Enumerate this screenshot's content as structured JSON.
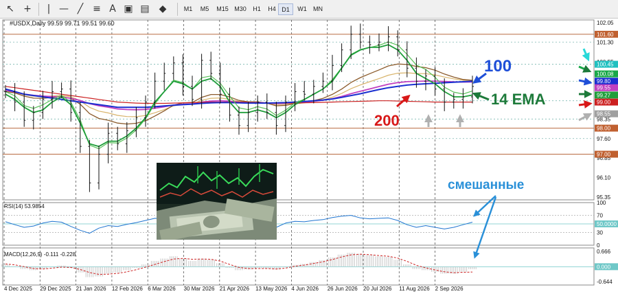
{
  "toolbar": {
    "icons": [
      "cursor-icon",
      "crosshair-icon",
      "horizontal-line-icon",
      "trendline-icon",
      "equidistant-channel-icon",
      "text-icon",
      "text-label-icon",
      "shapes-icon"
    ],
    "timeframes": [
      "M1",
      "M5",
      "M15",
      "M30",
      "H1",
      "H4",
      "D1",
      "W1",
      "MN"
    ],
    "active_timeframe": "D1"
  },
  "chart_header": {
    "symbol_line": "#USDX,Daily  99.59 99.71 99.51 99.60"
  },
  "indicators": {
    "rsi_label": "RSI(14) 53.9854",
    "macd_label": "MACD(12,26,9) -0.111 -0.228"
  },
  "annotations": {
    "label_100": "100",
    "label_200": "200",
    "label_ema": "14 EMA",
    "label_mixed": "смешанные"
  },
  "colors": {
    "price_bars": "#111111",
    "ema14": "#1e9e3a",
    "ema_brown": "#8b5a2b",
    "ema_tan": "#d8b36a",
    "ma_magenta": "#c040c0",
    "ma100_blue": "#1a2fd0",
    "ma200_red": "#cc2020",
    "rsi_line": "#1e74d0",
    "macd_hist": "#c8c8c8",
    "macd_signal": "#cc2020",
    "annotation_blue": "#1f4fd8",
    "annotation_red": "#d81818",
    "annotation_green": "#1d7a3a",
    "mixed_label": "#2a90d8"
  },
  "chart_data": [
    {
      "type": "line",
      "title": "#USDX,Daily",
      "x_tick_labels": [
        "4 Dec 2025",
        "29 Dec 2025",
        "21 Jan 2026",
        "12 Feb 2026",
        "6 Mar 2026",
        "30 Mar 2026",
        "21 Apr 2026",
        "13 May 2026",
        "4 Jun 2026",
        "26 Jun 2026",
        "20 Jul 2026",
        "11 Aug 2026",
        "2 Sep 2026"
      ],
      "y_tick_labels": [
        "102.05",
        "101.30",
        "100.55",
        "99.80",
        "99.05",
        "98.35",
        "97.60",
        "96.85",
        "96.10",
        "95.35"
      ],
      "price_tags": [
        {
          "label": "101.60",
          "value": 101.6,
          "color": "#c06030"
        },
        {
          "label": "100.45",
          "value": 100.45,
          "color": "#20c0c0"
        },
        {
          "label": "100.08",
          "value": 100.08,
          "color": "#18a848"
        },
        {
          "label": "99.80",
          "value": 99.8,
          "color": "#1a2fd0"
        },
        {
          "label": "99.55",
          "value": 99.55,
          "color": "#c040c0"
        },
        {
          "label": "99.27",
          "value": 99.27,
          "color": "#1e9e3a"
        },
        {
          "label": "99.00",
          "value": 99.0,
          "color": "#cc2020"
        },
        {
          "label": "98.55",
          "value": 98.55,
          "color": "#a0a0a0"
        },
        {
          "label": "98.00",
          "value": 98.0,
          "color": "#c06030"
        },
        {
          "label": "97.00",
          "value": 97.0,
          "color": "#c06030"
        }
      ],
      "horizontal_levels": [
        101.6,
        98.0,
        97.0
      ],
      "dashed_levels": [
        101.3,
        100.45,
        99.8,
        99.05,
        98.35,
        97.6
      ],
      "ylim": [
        95.25,
        102.15
      ],
      "series": [
        {
          "name": "close",
          "values": [
            99.4,
            99.0,
            98.3,
            98.6,
            99.1,
            99.4,
            99.5,
            98.6,
            97.3,
            95.9,
            97.0,
            97.8,
            97.4,
            97.9,
            98.4,
            99.0,
            99.8,
            100.1,
            100.5,
            99.6,
            99.1,
            100.6,
            100.1,
            99.3,
            98.5,
            98.1,
            98.6,
            99.0,
            98.6,
            98.1,
            99.0,
            99.4,
            99.3,
            99.6,
            99.8,
            100.4,
            101.0,
            101.6,
            101.3,
            101.2,
            101.3,
            101.5,
            101.0,
            100.3,
            99.8,
            100.0,
            99.5,
            99.0,
            99.1,
            99.2,
            99.6
          ]
        },
        {
          "name": "14 EMA",
          "values": [
            99.3,
            99.1,
            98.8,
            98.6,
            98.7,
            99.0,
            99.2,
            98.9,
            98.2,
            97.4,
            97.3,
            97.5,
            97.5,
            97.7,
            98.0,
            98.4,
            99.0,
            99.4,
            99.8,
            99.7,
            99.5,
            99.8,
            99.9,
            99.6,
            99.0,
            98.6,
            98.6,
            98.7,
            98.6,
            98.4,
            98.6,
            98.9,
            99.1,
            99.3,
            99.5,
            99.8,
            100.3,
            100.8,
            101.0,
            101.1,
            101.1,
            101.2,
            101.0,
            100.6,
            100.1,
            99.9,
            99.7,
            99.4,
            99.2,
            99.2,
            99.27
          ]
        },
        {
          "name": "100",
          "values": [
            99.5,
            99.4,
            99.3,
            99.25,
            99.2,
            99.15,
            99.1,
            99.05,
            99.0,
            98.95,
            98.9,
            98.85,
            98.8,
            98.8,
            98.8,
            98.8,
            98.82,
            98.85,
            98.88,
            98.9,
            98.92,
            98.95,
            98.97,
            98.98,
            98.98,
            98.97,
            98.96,
            98.96,
            98.96,
            98.97,
            98.98,
            99.0,
            99.02,
            99.05,
            99.08,
            99.12,
            99.18,
            99.25,
            99.32,
            99.4,
            99.48,
            99.55,
            99.6,
            99.65,
            99.68,
            99.7,
            99.72,
            99.74,
            99.76,
            99.78,
            99.8
          ]
        },
        {
          "name": "200",
          "values": [
            99.6,
            99.55,
            99.5,
            99.45,
            99.4,
            99.35,
            99.3,
            99.25,
            99.2,
            99.15,
            99.1,
            99.05,
            99.0,
            98.98,
            98.96,
            98.95,
            98.95,
            98.95,
            98.96,
            98.97,
            98.98,
            98.99,
            99.0,
            99.0,
            99.0,
            99.0,
            98.99,
            98.98,
            98.97,
            98.96,
            98.96,
            98.96,
            98.97,
            98.98,
            98.99,
            99.0,
            99.01,
            99.02,
            99.03,
            99.04,
            99.05,
            99.05,
            99.04,
            99.03,
            99.02,
            99.01,
            99.0,
            99.0,
            99.0,
            99.0,
            99.0
          ]
        }
      ]
    },
    {
      "type": "line",
      "title": "RSI(14) 53.9854",
      "y_tick_labels": [
        "100",
        "70",
        "50.0000",
        "30",
        "0"
      ],
      "levels": [
        70,
        50,
        30
      ],
      "ylim": [
        0,
        100
      ],
      "series": [
        {
          "name": "RSI(14)",
          "values": [
            55,
            48,
            42,
            45,
            52,
            56,
            54,
            44,
            35,
            28,
            40,
            46,
            44,
            49,
            53,
            58,
            63,
            62,
            66,
            52,
            48,
            60,
            55,
            46,
            40,
            38,
            45,
            50,
            46,
            42,
            52,
            56,
            55,
            58,
            60,
            65,
            68,
            70,
            64,
            62,
            63,
            64,
            58,
            48,
            42,
            46,
            42,
            38,
            42,
            48,
            54
          ]
        }
      ]
    },
    {
      "type": "bar",
      "title": "MACD(12,26,9) -0.111 -0.228",
      "y_tick_labels": [
        "0.666",
        "0.000",
        "-0.644"
      ],
      "ylim": [
        -0.7,
        0.72
      ],
      "series": [
        {
          "name": "MACD",
          "values": [
            0.1,
            0.02,
            -0.1,
            -0.15,
            -0.1,
            0.0,
            0.05,
            -0.05,
            -0.25,
            -0.45,
            -0.42,
            -0.3,
            -0.25,
            -0.15,
            -0.05,
            0.1,
            0.25,
            0.35,
            0.45,
            0.35,
            0.25,
            0.35,
            0.3,
            0.15,
            -0.05,
            -0.15,
            -0.12,
            -0.05,
            -0.08,
            -0.12,
            -0.02,
            0.08,
            0.12,
            0.2,
            0.28,
            0.4,
            0.52,
            0.6,
            0.55,
            0.5,
            0.45,
            0.42,
            0.3,
            0.1,
            -0.1,
            -0.15,
            -0.22,
            -0.3,
            -0.3,
            -0.22,
            -0.11
          ]
        },
        {
          "name": "signal",
          "values": [
            0.12,
            0.08,
            0.0,
            -0.08,
            -0.1,
            -0.06,
            -0.02,
            -0.03,
            -0.12,
            -0.25,
            -0.33,
            -0.32,
            -0.29,
            -0.22,
            -0.13,
            -0.02,
            0.1,
            0.22,
            0.33,
            0.36,
            0.32,
            0.33,
            0.32,
            0.24,
            0.1,
            -0.03,
            -0.08,
            -0.08,
            -0.08,
            -0.1,
            -0.06,
            0.02,
            0.07,
            0.14,
            0.21,
            0.31,
            0.42,
            0.51,
            0.54,
            0.52,
            0.48,
            0.45,
            0.37,
            0.23,
            0.06,
            -0.05,
            -0.14,
            -0.22,
            -0.26,
            -0.24,
            -0.23
          ]
        }
      ]
    }
  ]
}
